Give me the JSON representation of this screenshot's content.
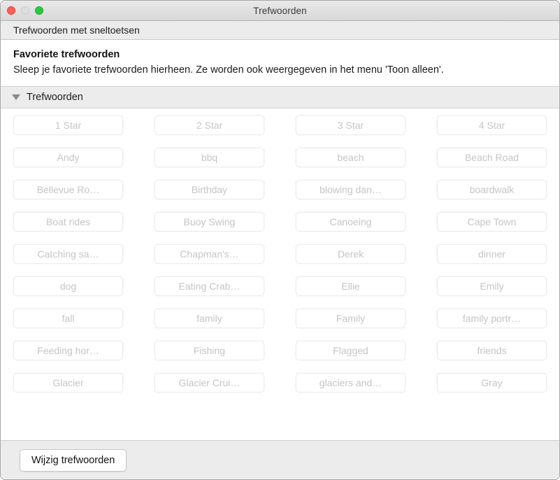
{
  "window": {
    "title": "Trefwoorden",
    "traffic_lights": [
      {
        "name": "close",
        "color": "#ff5f57"
      },
      {
        "name": "minimize",
        "color": "#dddddd"
      },
      {
        "name": "zoom",
        "color": "#28c840"
      }
    ]
  },
  "subheader": {
    "label": "Trefwoorden met sneltoetsen"
  },
  "favorites": {
    "title": "Favoriete trefwoorden",
    "description": "Sleep je favoriete trefwoorden hierheen. Ze worden ook weergegeven in het menu 'Toon alleen'."
  },
  "section": {
    "disclosure_icon": "triangle-down-icon",
    "title": "Trefwoorden",
    "expanded": true
  },
  "keywords": [
    "1 Star",
    "2 Star",
    "3 Star",
    "4 Star",
    "Andy",
    "bbq",
    "beach",
    "Beach Road",
    "Bellevue Ro…",
    "Birthday",
    "blowing dan…",
    "boardwalk",
    "Boat rides",
    "Buoy Swing",
    "Canoeing",
    "Cape Town",
    "Catching sa…",
    "Chapman's…",
    "Derek",
    "dinner",
    "dog",
    "Eating Crab…",
    "Ellie",
    "Emily",
    "fall",
    "family",
    "Family",
    "family portr…",
    "Feeding hor…",
    "Fishing",
    "Flagged",
    "friends",
    "Glacier",
    "Glacier Crui…",
    "glaciers and…",
    "Gray"
  ],
  "footer": {
    "edit_button_label": "Wijzig trefwoorden"
  },
  "colors": {
    "titlebar_top": "#e9e9e9",
    "titlebar_bottom": "#d8d8d8",
    "bar_background": "#ececec",
    "content_background": "#ffffff",
    "keyword_text": "#c5c5c5",
    "keyword_border": "#ededed",
    "body_text": "#1b1b1b"
  }
}
